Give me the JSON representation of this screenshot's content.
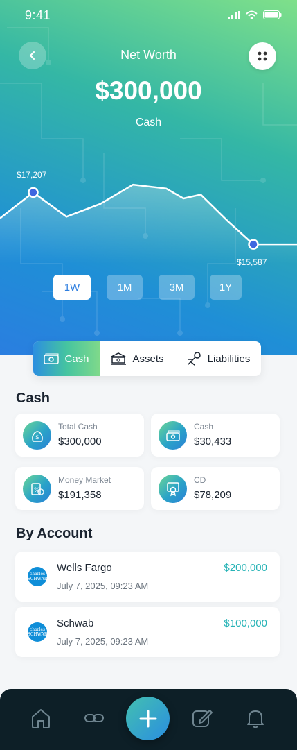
{
  "status_bar": {
    "time": "9:41"
  },
  "header": {
    "title": "Net Worth",
    "amount": "$300,000",
    "subtitle": "Cash"
  },
  "chart_data": {
    "type": "line",
    "points": [
      {
        "x": 0,
        "y": 16400
      },
      {
        "x": 1,
        "y": 17207
      },
      {
        "x": 2,
        "y": 16450
      },
      {
        "x": 3,
        "y": 16850
      },
      {
        "x": 4,
        "y": 17450
      },
      {
        "x": 5,
        "y": 17330
      },
      {
        "x": 6,
        "y": 17020
      },
      {
        "x": 7,
        "y": 17140
      },
      {
        "x": 8,
        "y": 16290
      },
      {
        "x": 9,
        "y": 15587
      },
      {
        "x": 10,
        "y": 15587
      }
    ],
    "annotations": [
      "$17,207",
      "$15,587"
    ],
    "highlighted_indices": [
      1,
      9
    ],
    "ylim": [
      15200,
      17800
    ]
  },
  "ranges": [
    "1W",
    "1M",
    "3M",
    "1Y"
  ],
  "active_range": "1W",
  "tabs": {
    "cash": "Cash",
    "assets": "Assets",
    "liabilities": "Liabilities"
  },
  "cash_section": {
    "title": "Cash",
    "cards": [
      {
        "label": "Total Cash",
        "value": "$300,000",
        "icon": "money-bag-icon"
      },
      {
        "label": "Cash",
        "value": "$30,433",
        "icon": "cash-stack-icon"
      },
      {
        "label": "Money Market",
        "value": "$191,358",
        "icon": "percent-doc-icon"
      },
      {
        "label": "CD",
        "value": "$78,209",
        "icon": "certificate-icon"
      }
    ]
  },
  "accounts_section": {
    "title": "By Account",
    "accounts": [
      {
        "name": "Wells Fargo",
        "date": "July 7, 2025, 09:23 AM",
        "amount": "$200,000",
        "logo_line1": "charles",
        "logo_line2": "SCHWAB"
      },
      {
        "name": "Schwab",
        "date": "July 7, 2025, 09:23 AM",
        "amount": "$100,000",
        "logo_line1": "charles",
        "logo_line2": "SCHWAB"
      }
    ]
  },
  "nav": [
    "home-icon",
    "link-icon",
    "plus-icon",
    "edit-icon",
    "bell-icon"
  ],
  "colors": {
    "accent": "#26b3b6",
    "nav_bg": "#0d1f27",
    "gradient_blue": "#2a7ee0",
    "gradient_green": "#7fe08a"
  }
}
